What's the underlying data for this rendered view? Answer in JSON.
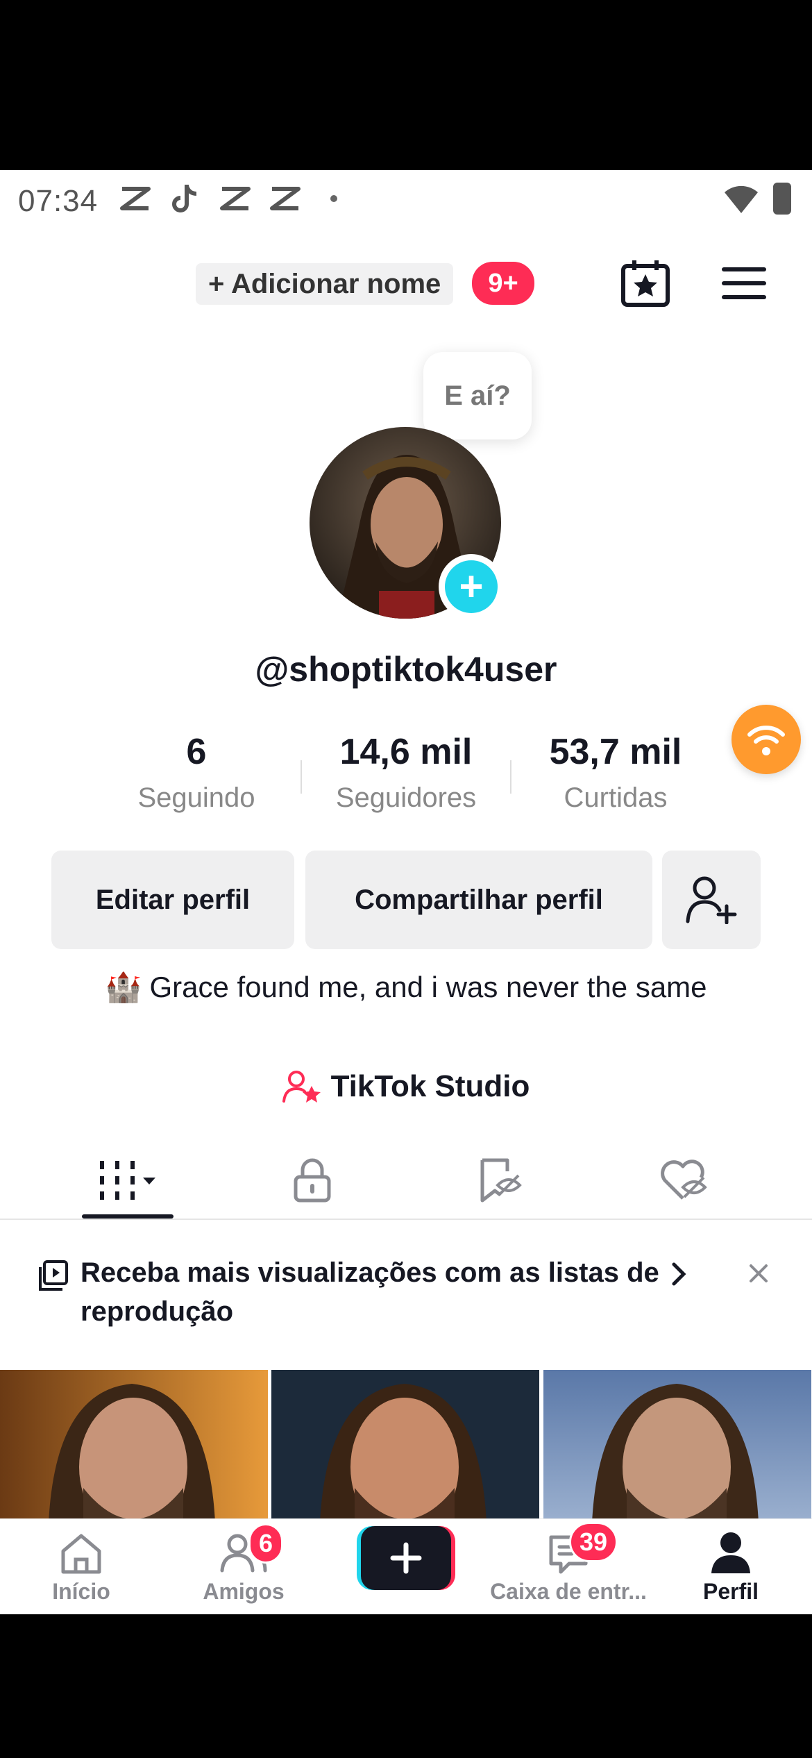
{
  "status_bar": {
    "time": "07:34"
  },
  "header": {
    "add_name": "+ Adicionar nome",
    "notif_badge": "9+"
  },
  "profile": {
    "bubble_text": "E aí?",
    "username": "@shoptiktok4user",
    "stats": [
      {
        "value": "6",
        "label": "Seguindo"
      },
      {
        "value": "14,6 mil",
        "label": "Seguidores"
      },
      {
        "value": "53,7 mil",
        "label": "Curtidas"
      }
    ],
    "buttons": {
      "edit": "Editar perfil",
      "share": "Compartilhar perfil"
    },
    "bio_emoji": "🏰",
    "bio": "Grace found me, and i was never the same",
    "studio": "TikTok Studio"
  },
  "banner": {
    "text": "Receba mais visualizações com as listas de reprodução"
  },
  "bottom_nav": [
    {
      "label": "Início",
      "badge": ""
    },
    {
      "label": "Amigos",
      "badge": "6"
    },
    {
      "label": "",
      "badge": ""
    },
    {
      "label": "Caixa de entr...",
      "badge": "39"
    },
    {
      "label": "Perfil",
      "badge": ""
    }
  ],
  "colors": {
    "accent_red": "#fe2c55",
    "accent_cyan": "#20d5ec",
    "text": "#161823"
  }
}
